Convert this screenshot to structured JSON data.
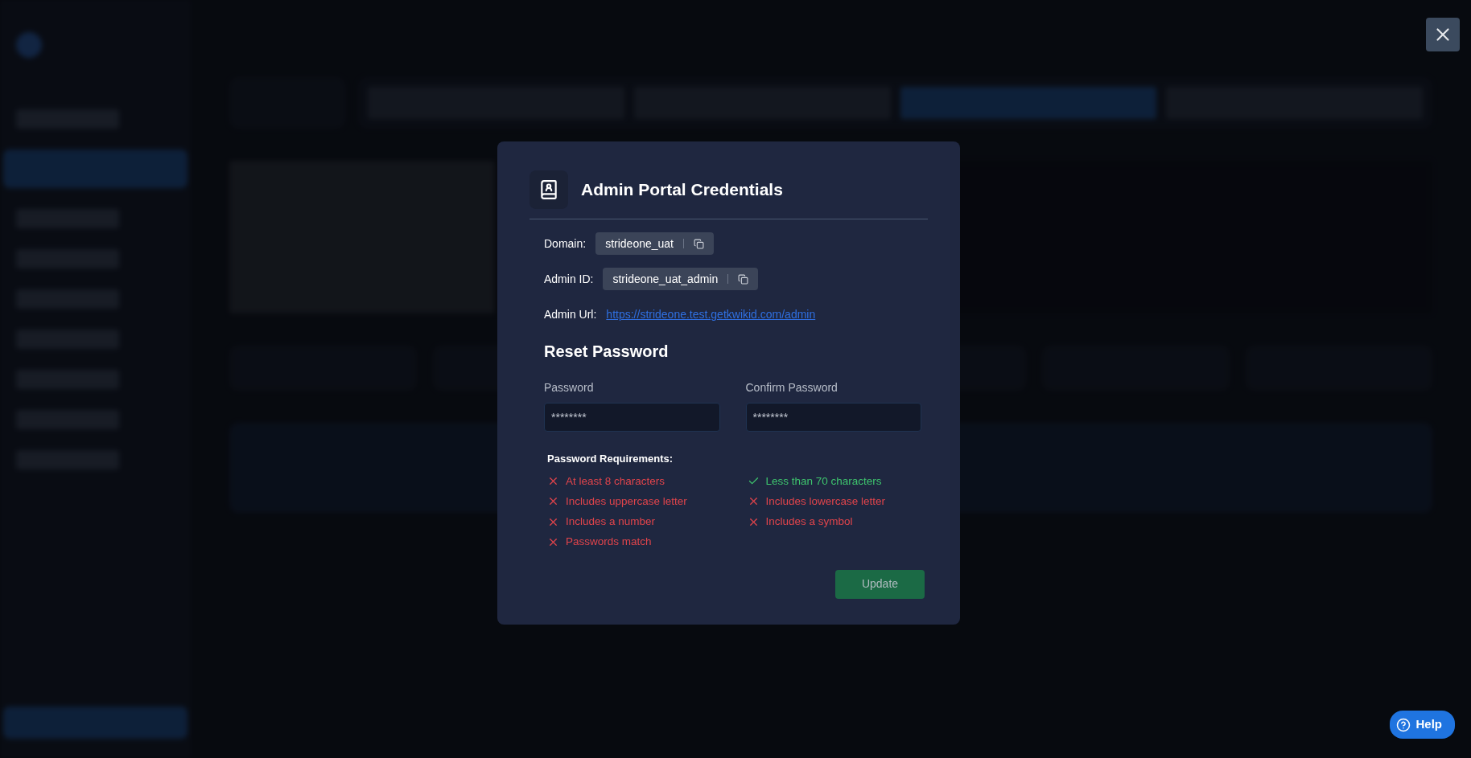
{
  "dialog": {
    "title": "Admin Portal Credentials",
    "fields": [
      {
        "label": "Domain:",
        "value": "strideone_uat"
      },
      {
        "label": "Admin ID:",
        "value": "strideone_uat_admin"
      }
    ],
    "url": {
      "label": "Admin Url:",
      "value": "https://strideone.test.getkwikid.com/admin"
    },
    "reset": {
      "title": "Reset Password",
      "inputs": [
        {
          "label": "Password",
          "value": "********"
        },
        {
          "label": "Confirm Password",
          "value": "********"
        }
      ],
      "requirements_title": "Password Requirements:",
      "requirements": [
        {
          "text": "At least 8 characters",
          "met": false
        },
        {
          "text": "Less than 70 characters",
          "met": true
        },
        {
          "text": "Includes uppercase letter",
          "met": false
        },
        {
          "text": "Includes lowercase letter",
          "met": false
        },
        {
          "text": "Includes a number",
          "met": false
        },
        {
          "text": "Includes a symbol",
          "met": false
        },
        {
          "text": "Passwords match",
          "met": false
        }
      ],
      "button": "Update"
    }
  },
  "help_button": "Help",
  "sidebar": {
    "items": [
      {
        "selected": false
      },
      {
        "selected": true
      },
      {
        "selected": false
      },
      {
        "selected": false
      },
      {
        "selected": false
      },
      {
        "selected": false
      },
      {
        "selected": false
      },
      {
        "selected": false
      },
      {
        "selected": false
      }
    ]
  },
  "category_tabs": [
    {
      "selected": false
    },
    {
      "selected": false
    },
    {
      "selected": true
    },
    {
      "selected": false
    }
  ]
}
